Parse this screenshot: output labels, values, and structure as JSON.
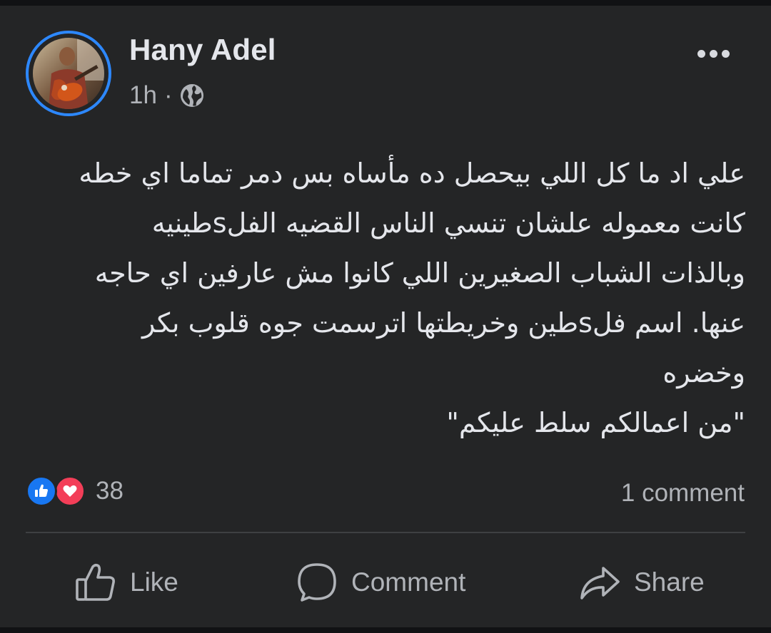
{
  "post": {
    "author": "Hany Adel",
    "time": "1h",
    "separator": "·",
    "privacy_icon": "globe-icon",
    "text_lines": [
      "علي اد ما كل اللي بيحصل ده مأساه بس دمر تماما اي خطه",
      "كانت معموله علشان تنسي الناس القضيه الفلsطينيه",
      "وبالذات الشباب الصغيرين اللي كانوا مش عارفين اي حاجه",
      "عنها. اسم فلsطين وخريطتها اترسمت جوه قلوب بكر",
      "وخضره",
      "\"من اعمالكم سلط عليكم\""
    ]
  },
  "reactions": {
    "icons": [
      "like-reaction-icon",
      "love-reaction-icon"
    ],
    "count": "38",
    "comments": "1 comment"
  },
  "actions": {
    "like": "Like",
    "comment": "Comment",
    "share": "Share"
  },
  "colors": {
    "background": "#242526",
    "text": "#e4e6eb",
    "muted": "#b0b3b8",
    "accent": "#2d88ff",
    "like": "#1877f2",
    "love": "#f33e58"
  }
}
